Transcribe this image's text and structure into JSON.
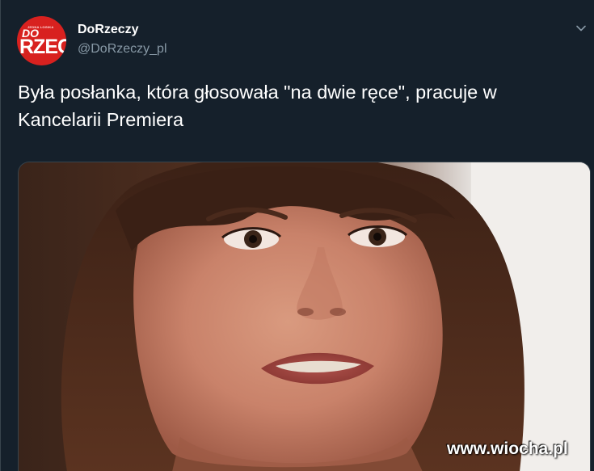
{
  "tweet": {
    "display_name": "DoRzeczy",
    "handle": "@DoRzeczy_pl",
    "text": "Była posłanka, która głosowała \"na dwie ręce\", pracuje w Kancelarii Premiera",
    "caret_icon": "chevron-down-icon"
  },
  "avatar": {
    "small_text": "JEDNA LOGIKA",
    "line1": "DO",
    "line2": "RZEC",
    "color": "#d8211f"
  },
  "watermark": {
    "text": "www.wiocha.pl"
  },
  "colors": {
    "background": "#15202b",
    "secondary_text": "#8899a6",
    "border": "#38444d"
  }
}
